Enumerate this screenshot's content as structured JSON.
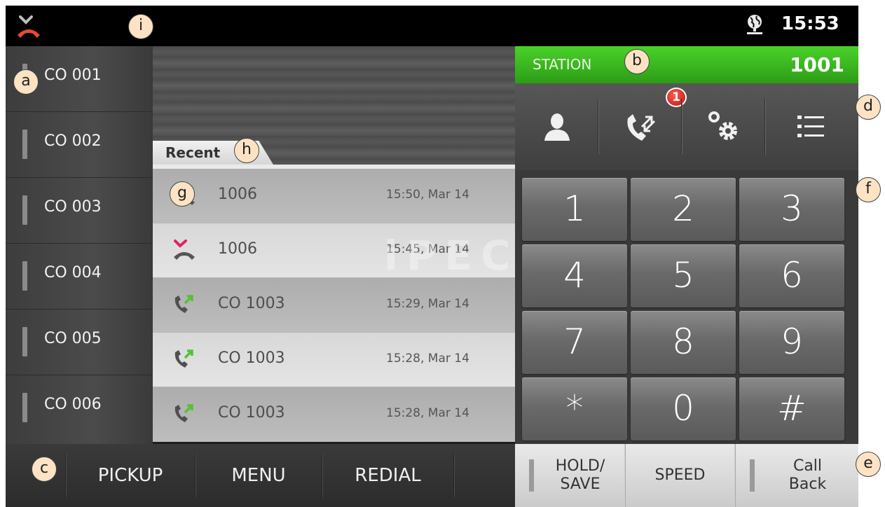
{
  "status_bar": {
    "time": "15:53",
    "left_icon": "missed-call-icon",
    "right_icon": "globe-network-icon"
  },
  "station": {
    "label": "STATION",
    "number": "1001",
    "color": "#3cbf22"
  },
  "co_lines": [
    "CO 001",
    "CO 002",
    "CO 003",
    "CO 004",
    "CO 005",
    "CO 006"
  ],
  "recent": {
    "tab_label": "Recent",
    "watermark": "iPECS",
    "rows": [
      {
        "icon": "missed-call-icon",
        "number": "1006",
        "time": "15:50, Mar 14"
      },
      {
        "icon": "missed-call-icon",
        "number": "1006",
        "time": "15:45, Mar 14"
      },
      {
        "icon": "outgoing-call-icon",
        "number": "CO 1003",
        "time": "15:29, Mar 14"
      },
      {
        "icon": "outgoing-call-icon",
        "number": "CO 1003",
        "time": "15:28, Mar 14"
      },
      {
        "icon": "outgoing-call-icon",
        "number": "CO 1003",
        "time": "15:28, Mar 14"
      }
    ]
  },
  "toolbar": {
    "icons": [
      "contacts-icon",
      "call-log-icon",
      "settings-gear-icon",
      "list-menu-icon"
    ],
    "badge_count": "1"
  },
  "keypad": {
    "keys": [
      "1",
      "2",
      "3",
      "4",
      "5",
      "6",
      "7",
      "8",
      "9",
      "*",
      "0",
      "#"
    ]
  },
  "softkeys": {
    "pickup": "PICKUP",
    "menu": "MENU",
    "redial": "REDIAL"
  },
  "function_keys": {
    "hold_save": "HOLD/\nSAVE",
    "speed": "SPEED",
    "call_back": "Call\nBack"
  },
  "callouts": {
    "a": "a",
    "b": "b",
    "c": "c",
    "d": "d",
    "e": "e",
    "f": "f",
    "g": "g",
    "h": "h",
    "i": "i"
  }
}
